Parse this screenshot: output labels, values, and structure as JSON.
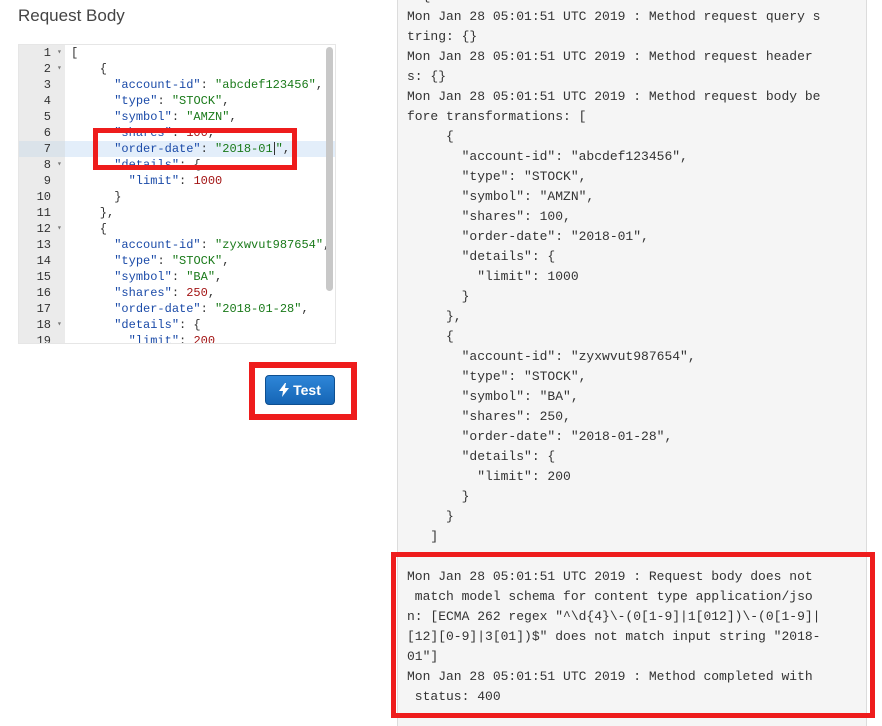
{
  "request_body": {
    "title": "Request Body",
    "lines": [
      {
        "num": "1",
        "fold": true,
        "tokens": [
          {
            "t": "p",
            "v": "["
          }
        ]
      },
      {
        "num": "2",
        "fold": true,
        "tokens": [
          {
            "t": "p",
            "v": "    {"
          }
        ]
      },
      {
        "num": "3",
        "fold": false,
        "tokens": [
          {
            "t": "p",
            "v": "      "
          },
          {
            "t": "k",
            "v": "\"account-id\""
          },
          {
            "t": "p",
            "v": ": "
          },
          {
            "t": "s",
            "v": "\"abcdef123456\""
          },
          {
            "t": "p",
            "v": ","
          }
        ]
      },
      {
        "num": "4",
        "fold": false,
        "tokens": [
          {
            "t": "p",
            "v": "      "
          },
          {
            "t": "k",
            "v": "\"type\""
          },
          {
            "t": "p",
            "v": ": "
          },
          {
            "t": "s",
            "v": "\"STOCK\""
          },
          {
            "t": "p",
            "v": ","
          }
        ]
      },
      {
        "num": "5",
        "fold": false,
        "tokens": [
          {
            "t": "p",
            "v": "      "
          },
          {
            "t": "k",
            "v": "\"symbol\""
          },
          {
            "t": "p",
            "v": ": "
          },
          {
            "t": "s",
            "v": "\"AMZN\""
          },
          {
            "t": "p",
            "v": ","
          }
        ]
      },
      {
        "num": "6",
        "fold": false,
        "tokens": [
          {
            "t": "p",
            "v": "      "
          },
          {
            "t": "k",
            "v": "\"shares\""
          },
          {
            "t": "p",
            "v": ": "
          },
          {
            "t": "n",
            "v": "100"
          },
          {
            "t": "p",
            "v": ","
          }
        ]
      },
      {
        "num": "7",
        "fold": false,
        "active": true,
        "tokens": [
          {
            "t": "p",
            "v": "      "
          },
          {
            "t": "k",
            "v": "\"order-date\""
          },
          {
            "t": "p",
            "v": ": "
          },
          {
            "t": "s",
            "v": "\"2018-01"
          },
          {
            "t": "cursor",
            "v": ""
          },
          {
            "t": "s",
            "v": "\""
          },
          {
            "t": "p",
            "v": ","
          }
        ]
      },
      {
        "num": "8",
        "fold": true,
        "tokens": [
          {
            "t": "p",
            "v": "      "
          },
          {
            "t": "k",
            "v": "\"details\""
          },
          {
            "t": "p",
            "v": ": {"
          }
        ]
      },
      {
        "num": "9",
        "fold": false,
        "tokens": [
          {
            "t": "p",
            "v": "        "
          },
          {
            "t": "k",
            "v": "\"limit\""
          },
          {
            "t": "p",
            "v": ": "
          },
          {
            "t": "n",
            "v": "1000"
          }
        ]
      },
      {
        "num": "10",
        "fold": false,
        "tokens": [
          {
            "t": "p",
            "v": "      }"
          }
        ]
      },
      {
        "num": "11",
        "fold": false,
        "tokens": [
          {
            "t": "p",
            "v": "    },"
          }
        ]
      },
      {
        "num": "12",
        "fold": true,
        "tokens": [
          {
            "t": "p",
            "v": "    {"
          }
        ]
      },
      {
        "num": "13",
        "fold": false,
        "tokens": [
          {
            "t": "p",
            "v": "      "
          },
          {
            "t": "k",
            "v": "\"account-id\""
          },
          {
            "t": "p",
            "v": ": "
          },
          {
            "t": "s",
            "v": "\"zyxwvut987654\""
          },
          {
            "t": "p",
            "v": ","
          }
        ]
      },
      {
        "num": "14",
        "fold": false,
        "tokens": [
          {
            "t": "p",
            "v": "      "
          },
          {
            "t": "k",
            "v": "\"type\""
          },
          {
            "t": "p",
            "v": ": "
          },
          {
            "t": "s",
            "v": "\"STOCK\""
          },
          {
            "t": "p",
            "v": ","
          }
        ]
      },
      {
        "num": "15",
        "fold": false,
        "tokens": [
          {
            "t": "p",
            "v": "      "
          },
          {
            "t": "k",
            "v": "\"symbol\""
          },
          {
            "t": "p",
            "v": ": "
          },
          {
            "t": "s",
            "v": "\"BA\""
          },
          {
            "t": "p",
            "v": ","
          }
        ]
      },
      {
        "num": "16",
        "fold": false,
        "tokens": [
          {
            "t": "p",
            "v": "      "
          },
          {
            "t": "k",
            "v": "\"shares\""
          },
          {
            "t": "p",
            "v": ": "
          },
          {
            "t": "n",
            "v": "250"
          },
          {
            "t": "p",
            "v": ","
          }
        ]
      },
      {
        "num": "17",
        "fold": false,
        "tokens": [
          {
            "t": "p",
            "v": "      "
          },
          {
            "t": "k",
            "v": "\"order-date\""
          },
          {
            "t": "p",
            "v": ": "
          },
          {
            "t": "s",
            "v": "\"2018-01-28\""
          },
          {
            "t": "p",
            "v": ","
          }
        ]
      },
      {
        "num": "18",
        "fold": true,
        "tokens": [
          {
            "t": "p",
            "v": "      "
          },
          {
            "t": "k",
            "v": "\"details\""
          },
          {
            "t": "p",
            "v": ": {"
          }
        ]
      },
      {
        "num": "19",
        "fold": false,
        "tokens": [
          {
            "t": "p",
            "v": "        "
          },
          {
            "t": "k",
            "v": "\"limit\""
          },
          {
            "t": "p",
            "v": ": "
          },
          {
            "t": "n",
            "v": "200"
          }
        ]
      }
    ]
  },
  "test_button": {
    "label": "Test",
    "icon": "lightning-bolt-icon"
  },
  "logs": {
    "lines": [
      "  {",
      "Mon Jan 28 05:01:51 UTC 2019 : Method request query s",
      "tring: {}",
      "Mon Jan 28 05:01:51 UTC 2019 : Method request header",
      "s: {}",
      "Mon Jan 28 05:01:51 UTC 2019 : Method request body be",
      "fore transformations: [",
      "     {",
      "       \"account-id\": \"abcdef123456\",",
      "       \"type\": \"STOCK\",",
      "       \"symbol\": \"AMZN\",",
      "       \"shares\": 100,",
      "       \"order-date\": \"2018-01\",",
      "       \"details\": {",
      "         \"limit\": 1000",
      "       }",
      "     },",
      "     {",
      "       \"account-id\": \"zyxwvut987654\",",
      "       \"type\": \"STOCK\",",
      "       \"symbol\": \"BA\",",
      "       \"shares\": 250,",
      "       \"order-date\": \"2018-01-28\",",
      "       \"details\": {",
      "         \"limit\": 200",
      "       }",
      "     }",
      "   ]",
      "",
      "Mon Jan 28 05:01:51 UTC 2019 : Request body does not",
      " match model schema for content type application/jso",
      "n: [ECMA 262 regex \"^\\d{4}\\-(0[1-9]|1[012])\\-(0[1-9]|",
      "[12][0-9]|3[01])$\" does not match input string \"2018-",
      "01\"]",
      "Mon Jan 28 05:01:51 UTC 2019 : Method completed with",
      " status: 400"
    ]
  },
  "colors": {
    "highlight": "#ee1c1c",
    "button": "#1d72c5",
    "key": "#1a4aa8",
    "string": "#1a7a1a",
    "number": "#a31515"
  }
}
